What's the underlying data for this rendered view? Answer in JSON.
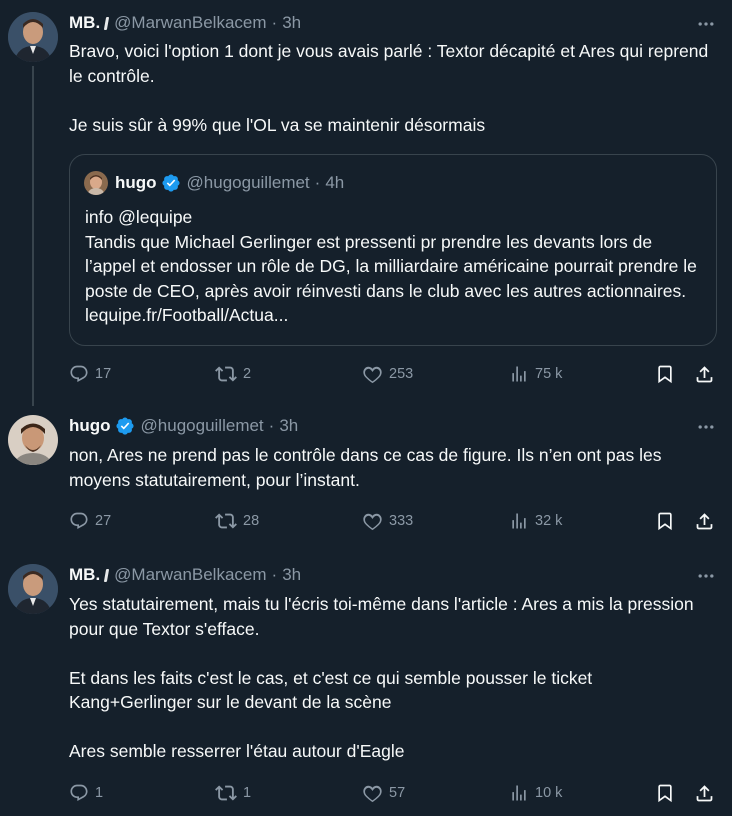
{
  "tweets": [
    {
      "name": "MB.",
      "handle": "@MarwanBelkacem",
      "time": "3h",
      "body": "Bravo, voici l'option 1 dont je vous avais parlé : Textor décapité et Ares qui reprend le contrôle.\n\nJe suis sûr à 99% que l'OL va se maintenir désormais",
      "quote": {
        "name": "hugo",
        "handle": "@hugoguillemet",
        "time": "4h",
        "body": "info @lequipe\nTandis que Michael Gerlinger est pressenti pr prendre les devants lors de l’appel et endosser un rôle de DG, la milliardaire américaine pourrait prendre le poste de CEO, après avoir réinvesti dans le club avec les autres actionnaires. lequipe.fr/Football/Actua..."
      },
      "replies": "17",
      "retweets": "2",
      "likes": "253",
      "views": "75 k"
    },
    {
      "name": "hugo",
      "handle": "@hugoguillemet",
      "time": "3h",
      "body": "non, Ares ne prend pas le contrôle dans ce cas de figure. Ils n’en ont pas les moyens statutairement, pour l’instant.",
      "replies": "27",
      "retweets": "28",
      "likes": "333",
      "views": "32 k"
    },
    {
      "name": "MB.",
      "handle": "@MarwanBelkacem",
      "time": "3h",
      "body": "Yes statutairement, mais tu l'écris toi-même dans l'article : Ares a mis la pression pour que Textor s'efface.\n\nEt dans les faits c'est le cas, et c'est ce qui semble pousser le ticket Kang+Gerlinger sur le devant de la scène\n\nAres semble resserrer l'étau autour d'Eagle",
      "replies": "1",
      "retweets": "1",
      "likes": "57",
      "views": "10 k"
    }
  ],
  "separator": "·",
  "colors": {
    "background": "#15202b",
    "text": "#f7f9f9",
    "muted": "#8b98a5",
    "border": "#38444d",
    "verified": "#1d9bf0"
  },
  "icons": [
    "more-icon",
    "verified-icon",
    "reply-icon",
    "retweet-icon",
    "like-icon",
    "views-icon",
    "bookmark-icon",
    "share-icon"
  ]
}
